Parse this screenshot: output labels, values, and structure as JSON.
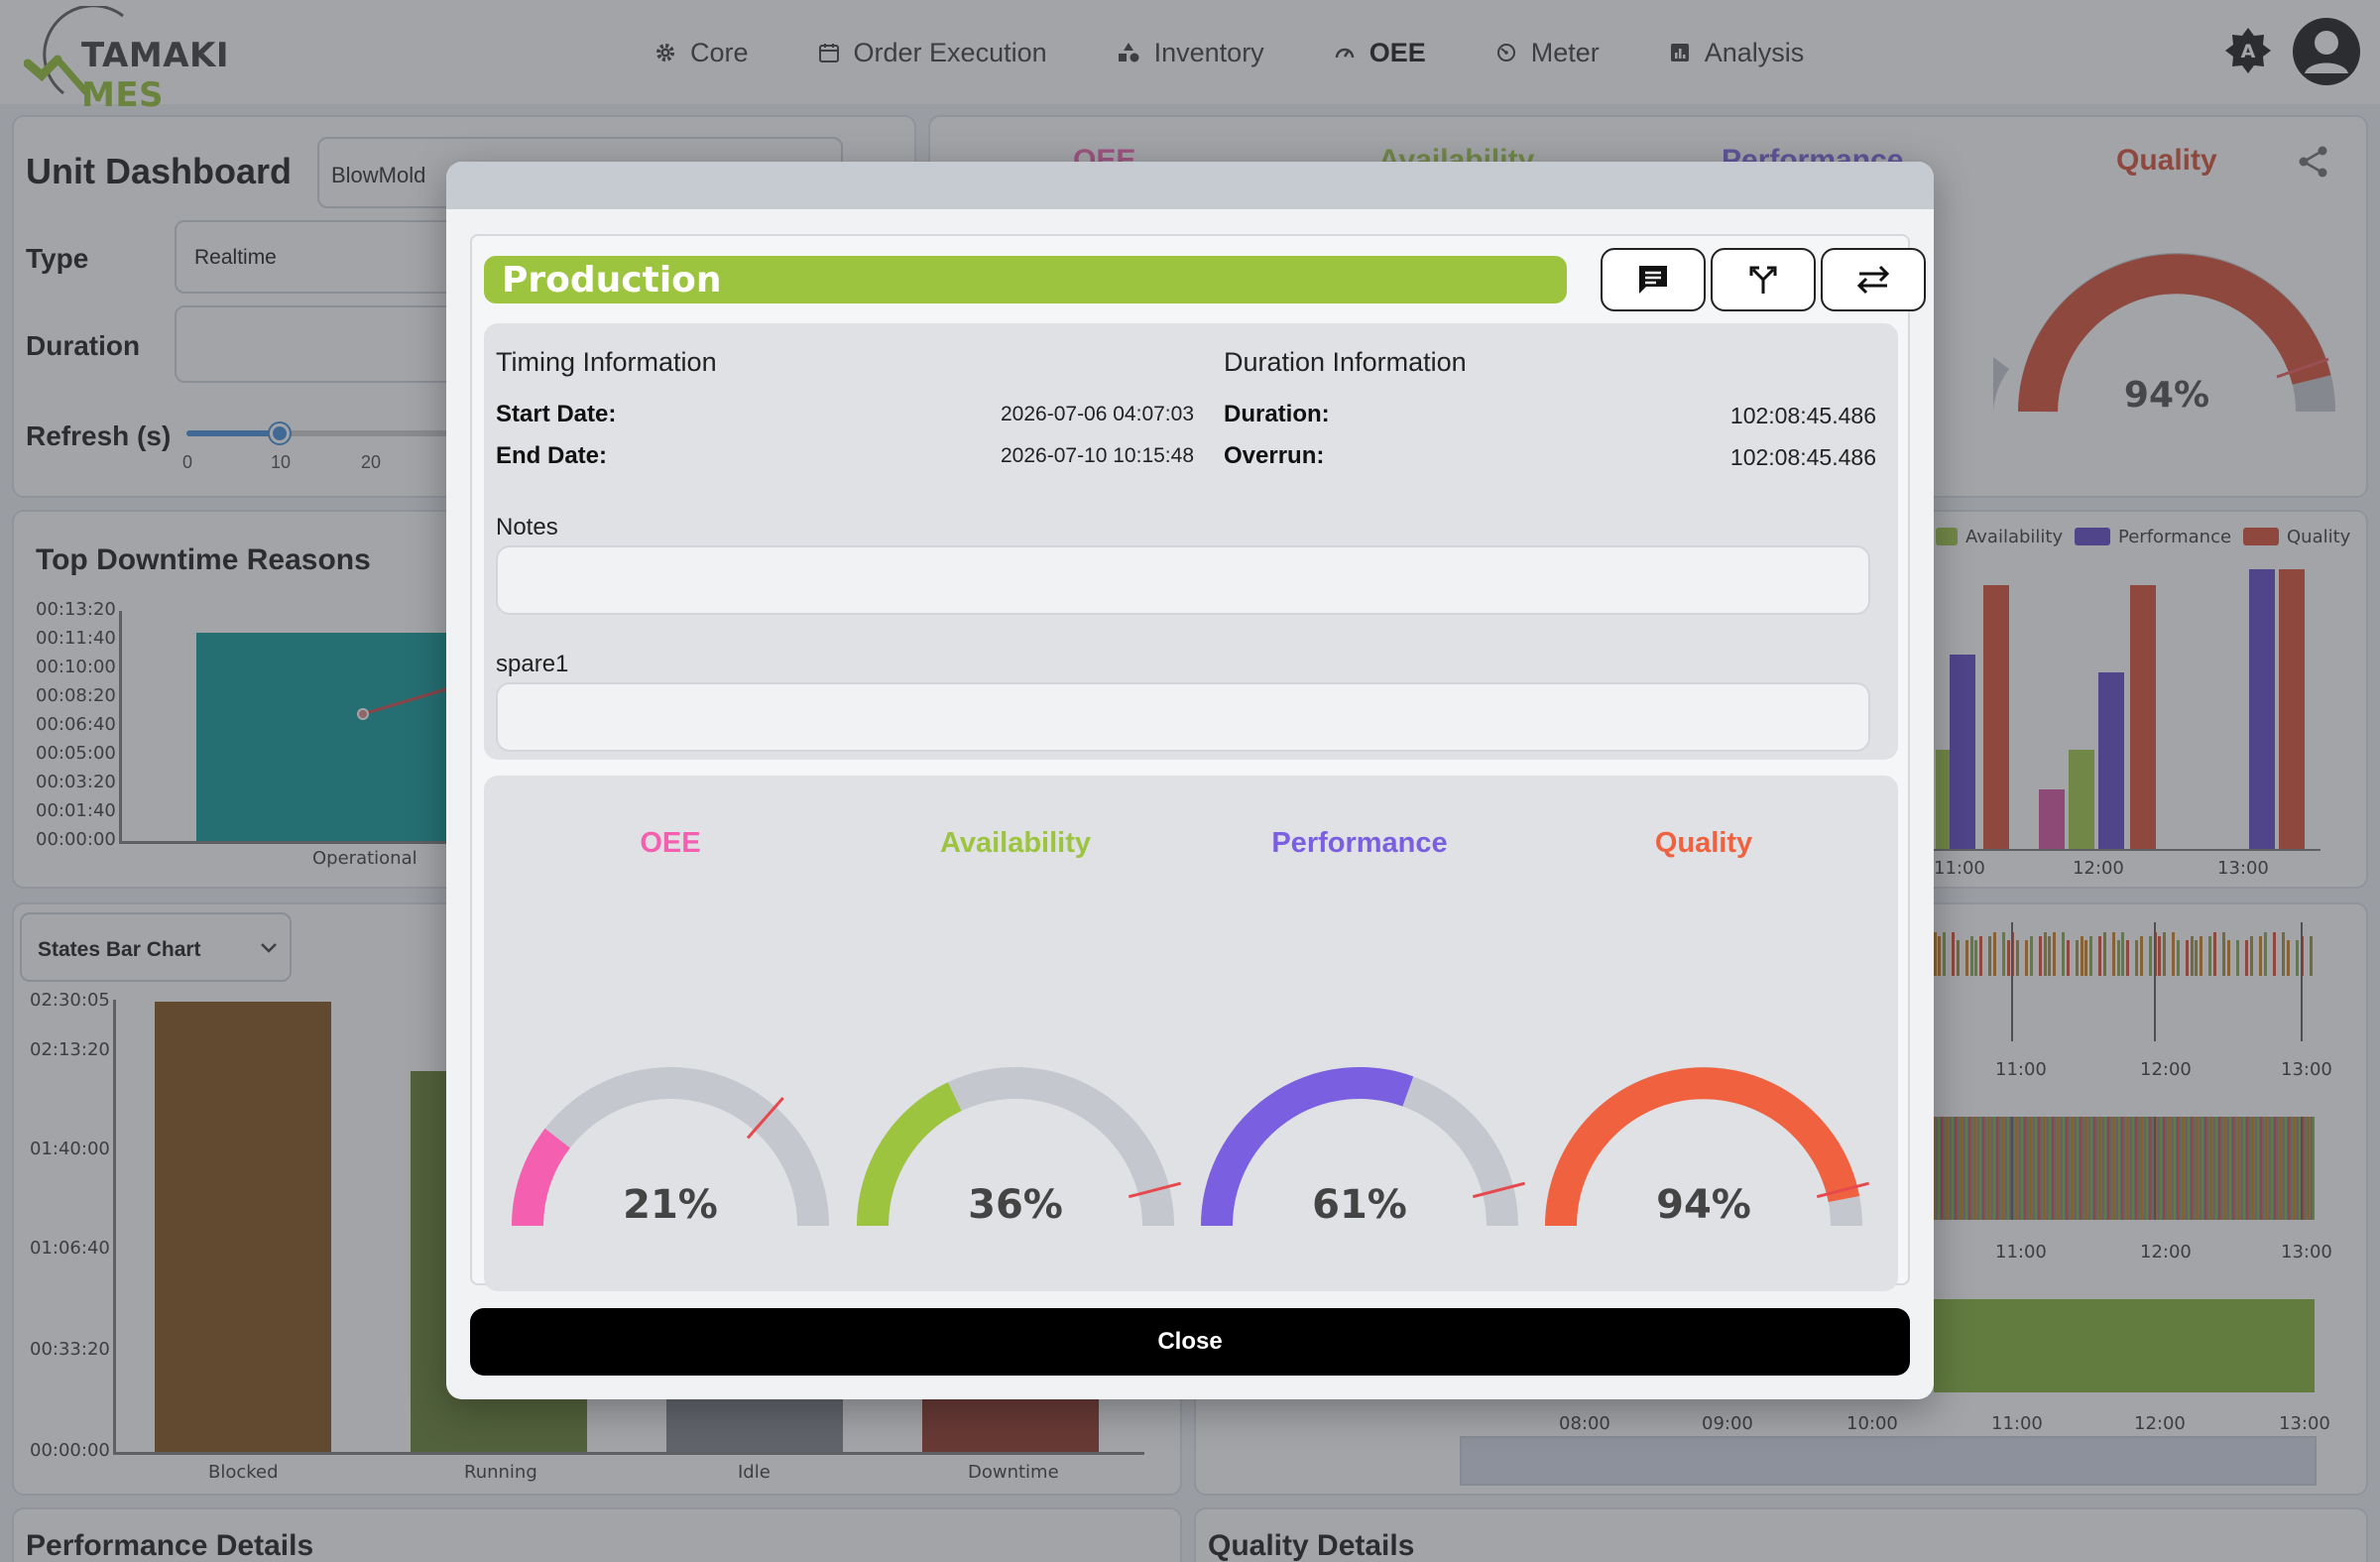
{
  "brand": {
    "name_part1": "TAMAKI",
    "name_part2": "MES"
  },
  "nav": {
    "items": [
      {
        "label": "Core",
        "icon": "gear-icon"
      },
      {
        "label": "Order Execution",
        "icon": "calendar-icon"
      },
      {
        "label": "Inventory",
        "icon": "shapes-icon"
      },
      {
        "label": "OEE",
        "icon": "speedometer-icon",
        "active": true
      },
      {
        "label": "Meter",
        "icon": "meter-icon"
      },
      {
        "label": "Analysis",
        "icon": "bar-chart-icon"
      }
    ]
  },
  "dashboard": {
    "title": "Unit Dashboard",
    "unit": "BlowMold",
    "type_label": "Type",
    "type_value": "Realtime",
    "duration_label": "Duration",
    "refresh_label": "Refresh (s)",
    "refresh_ticks": [
      "0",
      "10",
      "20"
    ],
    "refresh_value": 10,
    "tabs": [
      "OEE",
      "Availability",
      "Performance",
      "Quality"
    ],
    "bg_quality_value": "94%",
    "legend": [
      "Availability",
      "Performance",
      "Quality"
    ],
    "downtime_title": "Top Downtime Reasons",
    "downtime_yticks": [
      "00:13:20",
      "00:11:40",
      "00:10:00",
      "00:08:20",
      "00:06:40",
      "00:05:00",
      "00:03:20",
      "00:01:40",
      "00:00:00"
    ],
    "downtime_category": "Operational",
    "states_select": "States Bar Chart",
    "states_yticks": [
      "02:30:05",
      "02:13:20",
      "01:40:00",
      "01:06:40",
      "00:33:20",
      "00:00:00"
    ],
    "states_categories": [
      "Blocked",
      "Running",
      "Idle",
      "Downtime"
    ],
    "time_ticks_right": [
      "11:00",
      "12:00",
      "13:00"
    ],
    "time_ticks_bottom": [
      "08:00",
      "09:00",
      "10:00",
      "11:00",
      "12:00",
      "13:00"
    ],
    "perf_details": "Performance Details",
    "quality_details": "Quality Details"
  },
  "colors": {
    "production": "#9cc43e",
    "oee": "#f55fb0",
    "availability": "#9cc43e",
    "performance": "#7a5fe0",
    "quality": "#f0623f",
    "quality_bg": "#d9462b",
    "gauge_track": "#c4c7cd"
  },
  "modal": {
    "state_name": "Production",
    "buttons": {
      "comment": "comment-icon",
      "split": "split-icon",
      "swap": "swap-icon"
    },
    "timing": {
      "heading": "Timing Information",
      "start_label": "Start Date:",
      "start_value": "2026-07-06 04:07:03",
      "end_label": "End Date:",
      "end_value": "2026-07-10 10:15:48"
    },
    "duration": {
      "heading": "Duration Information",
      "duration_label": "Duration:",
      "duration_value": "102:08:45.486",
      "overrun_label": "Overrun:",
      "overrun_value": "102:08:45.486"
    },
    "notes_label": "Notes",
    "notes_value": "",
    "spare1_label": "spare1",
    "spare1_value": "",
    "gauges": [
      {
        "name": "OEE",
        "text": "21%",
        "value": 21,
        "target": 73
      },
      {
        "name": "Availability",
        "text": "36%",
        "value": 36,
        "target": 92
      },
      {
        "name": "Performance",
        "text": "61%",
        "value": 61,
        "target": 92
      },
      {
        "name": "Quality",
        "text": "94%",
        "value": 94,
        "target": 92
      }
    ],
    "close_label": "Close"
  }
}
